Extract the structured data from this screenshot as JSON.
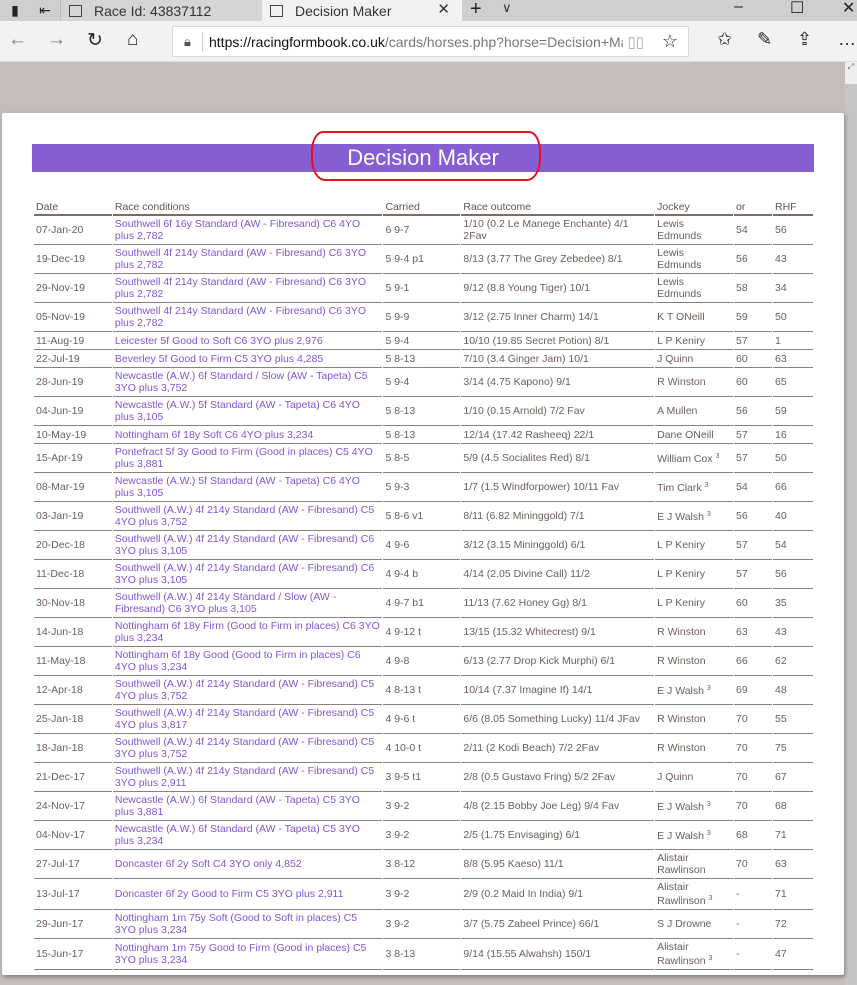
{
  "browser": {
    "tabs": [
      {
        "title": "Race Id: 43837112",
        "active": false
      },
      {
        "title": "Decision Maker",
        "active": true
      }
    ],
    "url_host": "https://racingformbook.co.uk",
    "url_path": "/cards/horses.php?horse=Decision+Maker",
    "icons": {
      "back": "←",
      "forward": "→",
      "refresh": "↻",
      "home": "⌂",
      "lock": "🔒",
      "reading_view": "📖",
      "favorite": "☆",
      "favorites_hub": "✩",
      "notes": "✎",
      "share": "⇪",
      "more": "…",
      "new_tab": "+",
      "tab_list": "∨",
      "minimize": "–",
      "maximize": "☐",
      "close": "✕"
    }
  },
  "page": {
    "title": "Decision Maker",
    "accent_color": "#845ed2",
    "annotation_color": "#e0141c",
    "columns": [
      "Date",
      "Race conditions",
      "Carried",
      "Race outcome",
      "Jockey",
      "or",
      "RHF"
    ],
    "rows": [
      {
        "date": "07-Jan-20",
        "conditions": "Southwell 6f 16y Standard (AW - Fibresand) C6 4YO plus 2,782",
        "carried": "6 9-7",
        "outcome": "1/10 (0.2 Le Manege Enchante) 4/1 2Fav",
        "jockey": "Lewis Edmunds",
        "jockey_sup": "",
        "or": "54",
        "rhf": "56"
      },
      {
        "date": "19-Dec-19",
        "conditions": "Southwell 4f 214y Standard (AW - Fibresand) C6 3YO plus 2,782",
        "carried": "5 9-4 p1",
        "outcome": "8/13 (3.77 The Grey Zebedee) 8/1",
        "jockey": "Lewis Edmunds",
        "jockey_sup": "",
        "or": "56",
        "rhf": "43"
      },
      {
        "date": "29-Nov-19",
        "conditions": "Southwell 4f 214y Standard (AW - Fibresand) C6 3YO plus 2,782",
        "carried": "5 9-1",
        "outcome": "9/12 (8.8 Young Tiger) 10/1",
        "jockey": "Lewis Edmunds",
        "jockey_sup": "",
        "or": "58",
        "rhf": "34"
      },
      {
        "date": "05-Nov-19",
        "conditions": "Southwell 4f 214y Standard (AW - Fibresand) C6 3YO plus 2,782",
        "carried": "5 9-9",
        "outcome": "3/12 (2.75 Inner Charm) 14/1",
        "jockey": "K T ONeill",
        "jockey_sup": "",
        "or": "59",
        "rhf": "50"
      },
      {
        "date": "11-Aug-19",
        "conditions": "Leicester 5f Good to Soft C6 3YO plus 2,976",
        "carried": "5 9-4",
        "outcome": "10/10 (19.85 Secret Potion) 8/1",
        "jockey": "L P Keniry",
        "jockey_sup": "",
        "or": "57",
        "rhf": "1"
      },
      {
        "date": "22-Jul-19",
        "conditions": "Beverley 5f Good to Firm C5 3YO plus 4,285",
        "carried": "5 8-13",
        "outcome": "7/10 (3.4 Ginger Jam) 10/1",
        "jockey": "J Quinn",
        "jockey_sup": "",
        "or": "60",
        "rhf": "63"
      },
      {
        "date": "28-Jun-19",
        "conditions": "Newcastle (A.W.) 6f Standard / Slow (AW - Tapeta) C5 3YO plus 3,752",
        "carried": "5 9-4",
        "outcome": "3/14 (4.75 Kapono) 9/1",
        "jockey": "R Winston",
        "jockey_sup": "",
        "or": "60",
        "rhf": "65"
      },
      {
        "date": "04-Jun-19",
        "conditions": "Newcastle (A.W.) 5f Standard (AW - Tapeta) C6 4YO plus 3,105",
        "carried": "5 8-13",
        "outcome": "1/10 (0.15 Arnold) 7/2 Fav",
        "jockey": "A Mullen",
        "jockey_sup": "",
        "or": "56",
        "rhf": "59"
      },
      {
        "date": "10-May-19",
        "conditions": "Nottingham 6f 18y Soft C6 4YO plus 3,234",
        "carried": "5 8-13",
        "outcome": "12/14 (17.42 Rasheeq) 22/1",
        "jockey": "Dane ONeill",
        "jockey_sup": "",
        "or": "57",
        "rhf": "16"
      },
      {
        "date": "15-Apr-19",
        "conditions": "Pontefract 5f 3y Good to Firm (Good in places) C5 4YO plus 3,881",
        "carried": "5 8-5",
        "outcome": "5/9 (4.5 Socialites Red) 8/1",
        "jockey": "William Cox",
        "jockey_sup": "3",
        "or": "57",
        "rhf": "50"
      },
      {
        "date": "08-Mar-19",
        "conditions": "Newcastle (A.W.) 5f Standard (AW - Tapeta) C6 4YO plus 3,105",
        "carried": "5 9-3",
        "outcome": "1/7 (1.5 Windforpower) 10/11 Fav",
        "jockey": "Tim Clark",
        "jockey_sup": "3",
        "or": "54",
        "rhf": "66"
      },
      {
        "date": "03-Jan-19",
        "conditions": "Southwell (A.W.) 4f 214y Standard (AW - Fibresand) C5 4YO plus 3,752",
        "carried": "5 8-6 v1",
        "outcome": "8/11 (6.82 Mininggold) 7/1",
        "jockey": "E J Walsh",
        "jockey_sup": "3",
        "or": "56",
        "rhf": "40"
      },
      {
        "date": "20-Dec-18",
        "conditions": "Southwell (A.W.) 4f 214y Standard (AW - Fibresand) C6 3YO plus 3,105",
        "carried": "4 9-6",
        "outcome": "3/12 (3.15 Mininggold) 6/1",
        "jockey": "L P Keniry",
        "jockey_sup": "",
        "or": "57",
        "rhf": "54"
      },
      {
        "date": "11-Dec-18",
        "conditions": "Southwell (A.W.) 4f 214y Standard (AW - Fibresand) C6 3YO plus 3,105",
        "carried": "4 9-4 b",
        "outcome": "4/14 (2.05 Divine Call) 11/2",
        "jockey": "L P Keniry",
        "jockey_sup": "",
        "or": "57",
        "rhf": "56"
      },
      {
        "date": "30-Nov-18",
        "conditions": "Southwell (A.W.) 4f 214y Standard / Slow (AW - Fibresand) C6 3YO plus 3,105",
        "carried": "4 9-7 b1",
        "outcome": "11/13 (7.62 Honey Gg) 8/1",
        "jockey": "L P Keniry",
        "jockey_sup": "",
        "or": "60",
        "rhf": "35"
      },
      {
        "date": "14-Jun-18",
        "conditions": "Nottingham 6f 18y Firm (Good to Firm in places) C6 3YO plus 3,234",
        "carried": "4 9-12 t",
        "outcome": "13/15 (15.32 Whitecrest) 9/1",
        "jockey": "R Winston",
        "jockey_sup": "",
        "or": "63",
        "rhf": "43"
      },
      {
        "date": "11-May-18",
        "conditions": "Nottingham 6f 18y Good (Good to Firm in places) C6 4YO plus 3,234",
        "carried": "4 9-8",
        "outcome": "6/13 (2.77 Drop Kick Murphi) 6/1",
        "jockey": "R Winston",
        "jockey_sup": "",
        "or": "66",
        "rhf": "62"
      },
      {
        "date": "12-Apr-18",
        "conditions": "Southwell (A.W.) 4f 214y Standard (AW - Fibresand) C5 4YO plus 3,752",
        "carried": "4 8-13 t",
        "outcome": "10/14 (7.37 Imagine If) 14/1",
        "jockey": "E J Walsh",
        "jockey_sup": "3",
        "or": "69",
        "rhf": "48"
      },
      {
        "date": "25-Jan-18",
        "conditions": "Southwell (A.W.) 4f 214y Standard (AW - Fibresand) C5 4YO plus 3,817",
        "carried": "4 9-6 t",
        "outcome": "6/6 (8.05 Something Lucky) 11/4 JFav",
        "jockey": "R Winston",
        "jockey_sup": "",
        "or": "70",
        "rhf": "55"
      },
      {
        "date": "18-Jan-18",
        "conditions": "Southwell (A.W.) 4f 214y Standard (AW - Fibresand) C5 3YO plus 3,752",
        "carried": "4 10-0 t",
        "outcome": "2/11 (2 Kodi Beach) 7/2 2Fav",
        "jockey": "R Winston",
        "jockey_sup": "",
        "or": "70",
        "rhf": "75"
      },
      {
        "date": "21-Dec-17",
        "conditions": "Southwell (A.W.) 4f 214y Standard (AW - Fibresand) C5 3YO plus 2,911",
        "carried": "3 9-5 t1",
        "outcome": "2/8 (0.5 Gustavo Fring) 5/2 2Fav",
        "jockey": "J Quinn",
        "jockey_sup": "",
        "or": "70",
        "rhf": "67"
      },
      {
        "date": "24-Nov-17",
        "conditions": "Newcastle (A.W.) 6f Standard (AW - Tapeta) C5 3YO plus 3,881",
        "carried": "3 9-2",
        "outcome": "4/8 (2.15 Bobby Joe Leg) 9/4 Fav",
        "jockey": "E J Walsh",
        "jockey_sup": "3",
        "or": "70",
        "rhf": "68"
      },
      {
        "date": "04-Nov-17",
        "conditions": "Newcastle (A.W.) 6f Standard (AW - Tapeta) C5 3YO plus 3,234",
        "carried": "3 9-2",
        "outcome": "2/5 (1.75 Envisaging) 6/1",
        "jockey": "E J Walsh",
        "jockey_sup": "3",
        "or": "68",
        "rhf": "71"
      },
      {
        "date": "27-Jul-17",
        "conditions": "Doncaster 6f 2y Soft C4 3YO only 4,852",
        "carried": "3 8-12",
        "outcome": "8/8 (5.95 Kaeso) 11/1",
        "jockey": "Alistair Rawlinson",
        "jockey_sup": "",
        "or": "70",
        "rhf": "63"
      },
      {
        "date": "13-Jul-17",
        "conditions": "Doncaster 6f 2y Good to Firm C5 3YO plus 2,911",
        "carried": "3 9-2",
        "outcome": "2/9 (0.2 Maid In India) 9/1",
        "jockey": "Alistair Rawlinson",
        "jockey_sup": "3",
        "or": "-",
        "rhf": "71"
      },
      {
        "date": "29-Jun-17",
        "conditions": "Nottingham 1m 75y Soft (Good to Soft in places) C5 3YO plus 3,234",
        "carried": "3 9-2",
        "outcome": "3/7 (5.75 Zabeel Prince) 66/1",
        "jockey": "S J Drowne",
        "jockey_sup": "",
        "or": "-",
        "rhf": "72"
      },
      {
        "date": "15-Jun-17",
        "conditions": "Nottingham 1m 75y Good to Firm (Good in places) C5 3YO plus 3,234",
        "carried": "3 8-13",
        "outcome": "9/14 (15.55 Alwahsh) 150/1",
        "jockey": "Alistair Rawlinson",
        "jockey_sup": "3",
        "or": "-",
        "rhf": "47"
      }
    ]
  }
}
